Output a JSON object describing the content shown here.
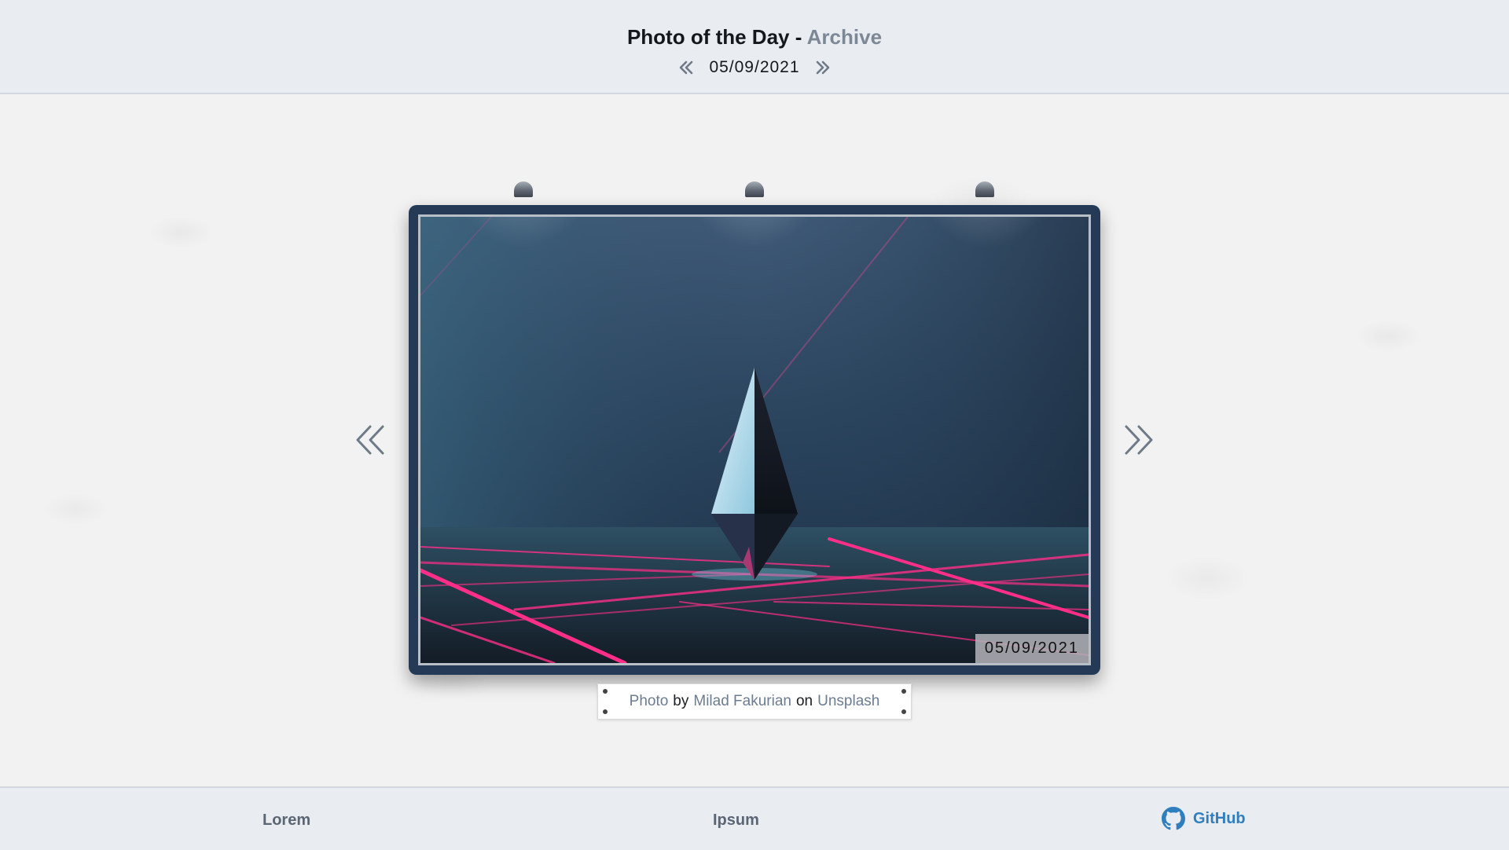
{
  "header": {
    "title": "Photo of the Day -",
    "title_accent": "Archive",
    "date": "05/09/2021"
  },
  "photo": {
    "date_stamp": "05/09/2021",
    "icons": [
      "chevron-double-left-icon",
      "chevron-double-right-icon"
    ]
  },
  "credit": {
    "photo_link": "Photo",
    "by": "by",
    "author": "Milad Fakurian",
    "on": "on",
    "site": "Unsplash"
  },
  "footer": {
    "lorem": "Lorem",
    "ipsum": "Ipsum",
    "github": "GitHub",
    "github_color": "#2f7fbf"
  },
  "colors": {
    "frame": "#243a57",
    "accent": "#7d8896",
    "link": "#6c7c90"
  }
}
